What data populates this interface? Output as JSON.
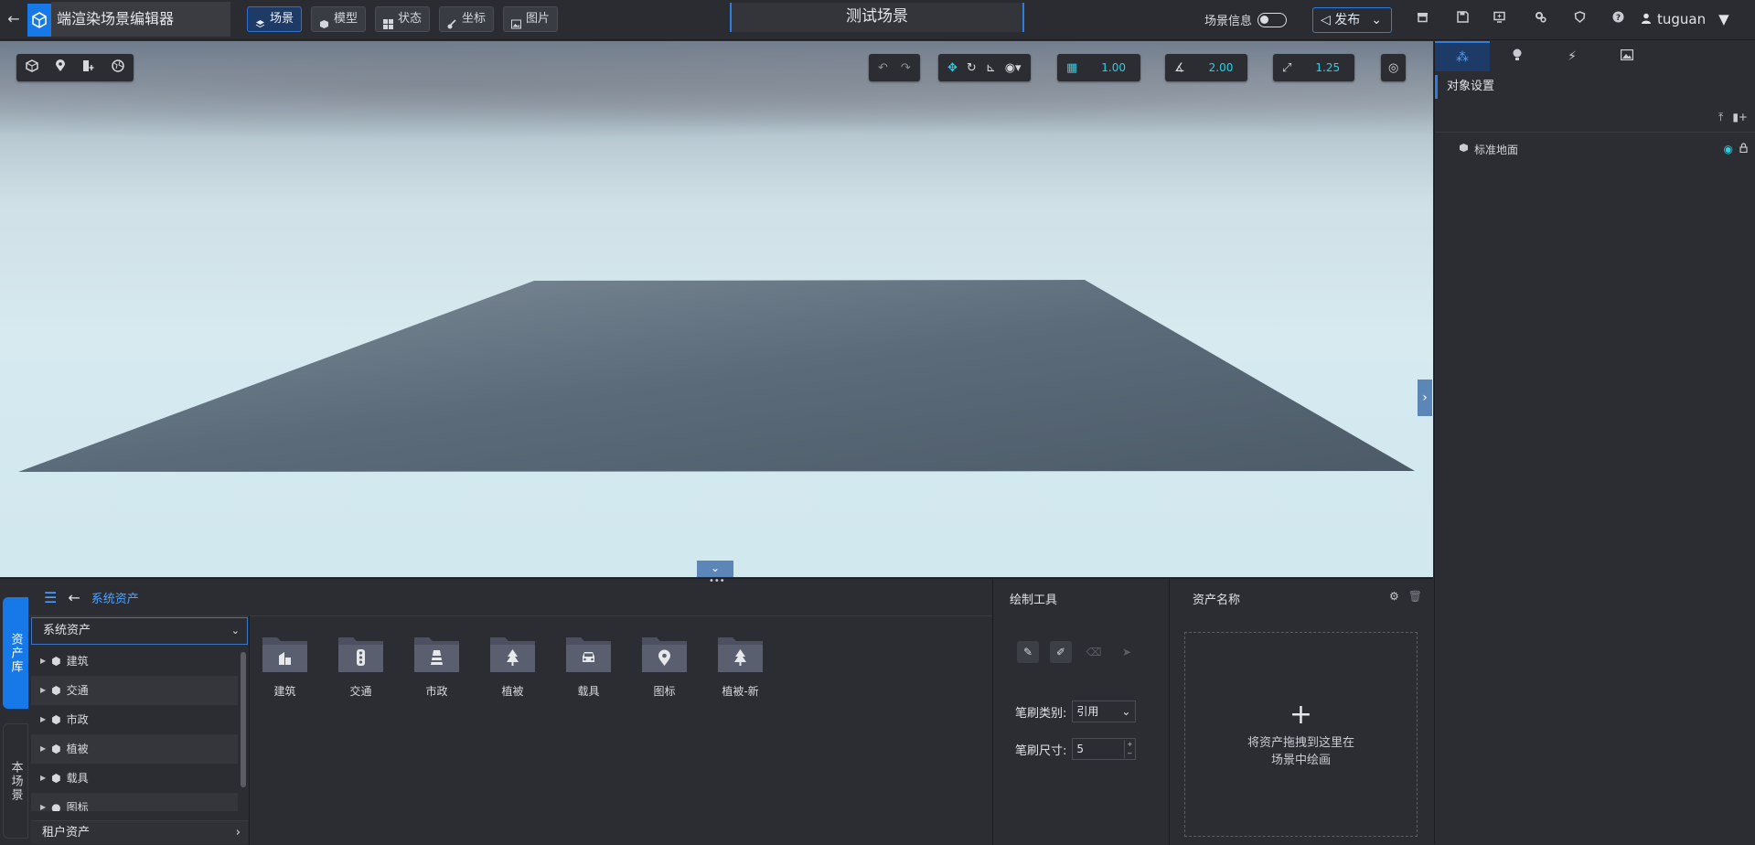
{
  "app": {
    "title": "端渲染场景编辑器"
  },
  "topnav": [
    {
      "label": "场景",
      "active": true
    },
    {
      "label": "模型",
      "active": false
    },
    {
      "label": "状态",
      "active": false
    },
    {
      "label": "坐标",
      "active": false
    },
    {
      "label": "图片",
      "active": false
    }
  ],
  "scene": {
    "title": "测试场景",
    "info_label": "场景信息",
    "publish_label": "发布"
  },
  "user": {
    "name": "tuguan"
  },
  "viewport": {
    "grid_value": "1.00",
    "angle_value": "2.00",
    "scale_value": "1.25"
  },
  "right_panel": {
    "section_title": "对象设置",
    "tree": [
      {
        "label": "标准地面"
      }
    ]
  },
  "bottom": {
    "side_tabs": {
      "asset": "资产库",
      "scene": "本场景"
    },
    "breadcrumb": "系统资产",
    "system_dropdown": "系统资产",
    "tree_items": [
      "建筑",
      "交通",
      "市政",
      "植被",
      "载具",
      "图标"
    ],
    "tenant_label": "租户资产",
    "folders": [
      "建筑",
      "交通",
      "市政",
      "植被",
      "载具",
      "图标",
      "植被-新"
    ],
    "draw_tools": {
      "title": "绘制工具",
      "brush_type_label": "笔刷类别:",
      "brush_type_value": "引用",
      "brush_size_label": "笔刷尺寸:",
      "brush_size_value": "5"
    },
    "asset_name": {
      "title": "资产名称",
      "drop_line1": "将资产拖拽到这里在",
      "drop_line2": "场景中绘画"
    }
  },
  "colors": {
    "accent": "#1778e8",
    "value_cyan": "#22d3e8",
    "panel_bg": "#2b2d33"
  }
}
